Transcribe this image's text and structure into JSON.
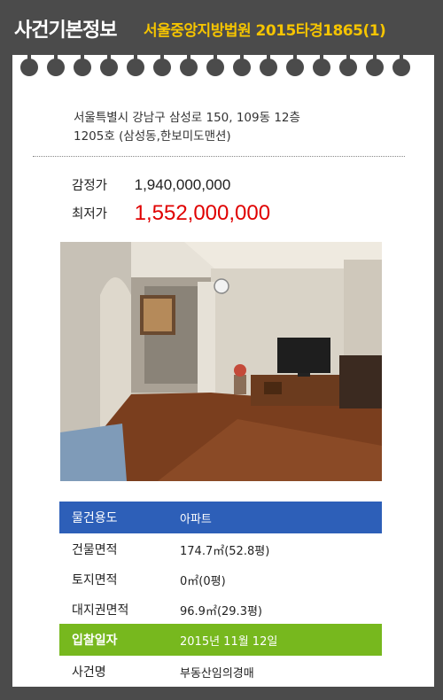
{
  "header": {
    "title": "사건기본정보",
    "subtitle": "서울중앙지방법원 2015타경1865(1)"
  },
  "address": {
    "line1": "서울특별시 강남구 삼성로 150, 109동 12층",
    "line2": "1205호 (삼성동,한보미도맨션)"
  },
  "prices": {
    "appraisal_label": "감정가",
    "appraisal_value": "1,940,000,000",
    "minimum_label": "최저가",
    "minimum_value": "1,552,000,000"
  },
  "info": [
    {
      "label": "물건용도",
      "value": "아파트"
    },
    {
      "label": "건물면적",
      "value": "174.7㎡(52.8평)"
    },
    {
      "label": "토지면적",
      "value": "0㎡(0평)"
    },
    {
      "label": "대지권면적",
      "value": "96.9㎡(29.3평)"
    },
    {
      "label": "입찰일자",
      "value": "2015년 11월 12일"
    },
    {
      "label": "사건명",
      "value": "부동산임의경매"
    }
  ],
  "colors": {
    "background": "#4b4b4b",
    "title_accent": "#f5c400",
    "min_price": "#e00000",
    "usage_row": "#2d5fb8",
    "bid_row": "#77b81e"
  },
  "icons": [
    "binder-hole-icon"
  ]
}
